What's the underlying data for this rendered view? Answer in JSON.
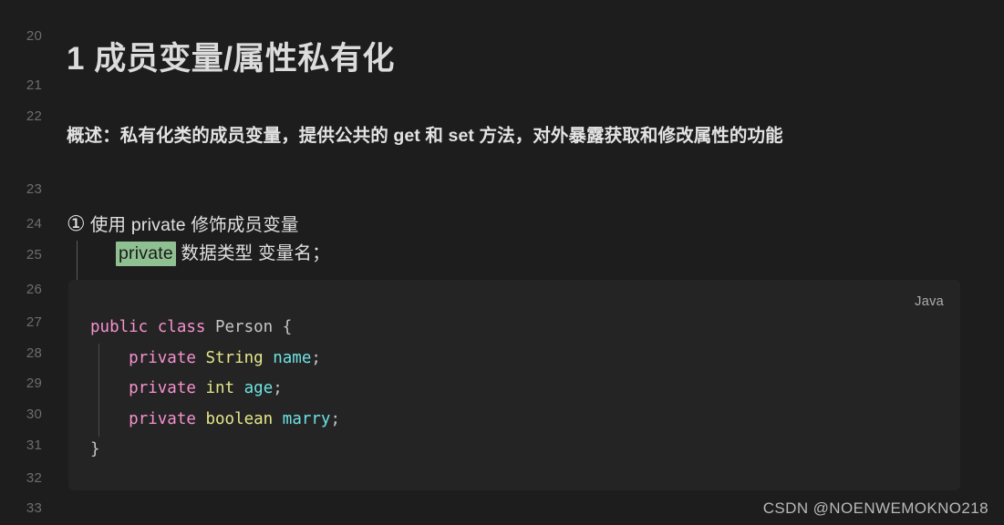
{
  "editor": {
    "background_color": "#1d1d1d",
    "code_background_color": "#242424",
    "gutter": {
      "line_numbers": [
        "20",
        "21",
        "22",
        "23",
        "24",
        "25",
        "26",
        "27",
        "28",
        "29",
        "30",
        "31",
        "32",
        "33"
      ]
    }
  },
  "heading": {
    "text": "1 成员变量/属性私有化"
  },
  "description": {
    "text": "概述：私有化类的成员变量，提供公共的 get 和 set 方法，对外暴露获取和修改属性的功能"
  },
  "list": {
    "marker": "①",
    "item_label": "使用 private 修饰成员变量",
    "sub_line": {
      "highlight_text": "private",
      "highlight_color": "#8fc091",
      "rest_text": " 数据类型 变量名；"
    }
  },
  "code": {
    "language_label": "Java",
    "lines": [
      [
        {
          "t": "public",
          "c": "kw"
        },
        {
          "t": " ",
          "c": "plain"
        },
        {
          "t": "class",
          "c": "kw"
        },
        {
          "t": " Person {",
          "c": "plain"
        }
      ],
      [
        {
          "t": "    ",
          "c": "plain"
        },
        {
          "t": "private",
          "c": "kw"
        },
        {
          "t": " ",
          "c": "plain"
        },
        {
          "t": "String",
          "c": "type"
        },
        {
          "t": " ",
          "c": "plain"
        },
        {
          "t": "name",
          "c": "ident"
        },
        {
          "t": ";",
          "c": "punc"
        }
      ],
      [
        {
          "t": "    ",
          "c": "plain"
        },
        {
          "t": "private",
          "c": "kw"
        },
        {
          "t": " ",
          "c": "plain"
        },
        {
          "t": "int",
          "c": "type"
        },
        {
          "t": " ",
          "c": "plain"
        },
        {
          "t": "age",
          "c": "ident"
        },
        {
          "t": ";",
          "c": "punc"
        }
      ],
      [
        {
          "t": "    ",
          "c": "plain"
        },
        {
          "t": "private",
          "c": "kw"
        },
        {
          "t": " ",
          "c": "plain"
        },
        {
          "t": "boolean",
          "c": "type"
        },
        {
          "t": " ",
          "c": "plain"
        },
        {
          "t": "marry",
          "c": "ident"
        },
        {
          "t": ";",
          "c": "punc"
        }
      ],
      [
        {
          "t": "}",
          "c": "plain"
        }
      ]
    ],
    "syntax_colors": {
      "keyword": "#f692ce",
      "type": "#e6e68a",
      "identifier": "#6ee2e2",
      "plain": "#c6c6c6"
    }
  },
  "watermark": {
    "text": "CSDN @NOENWEMOKNO218"
  }
}
